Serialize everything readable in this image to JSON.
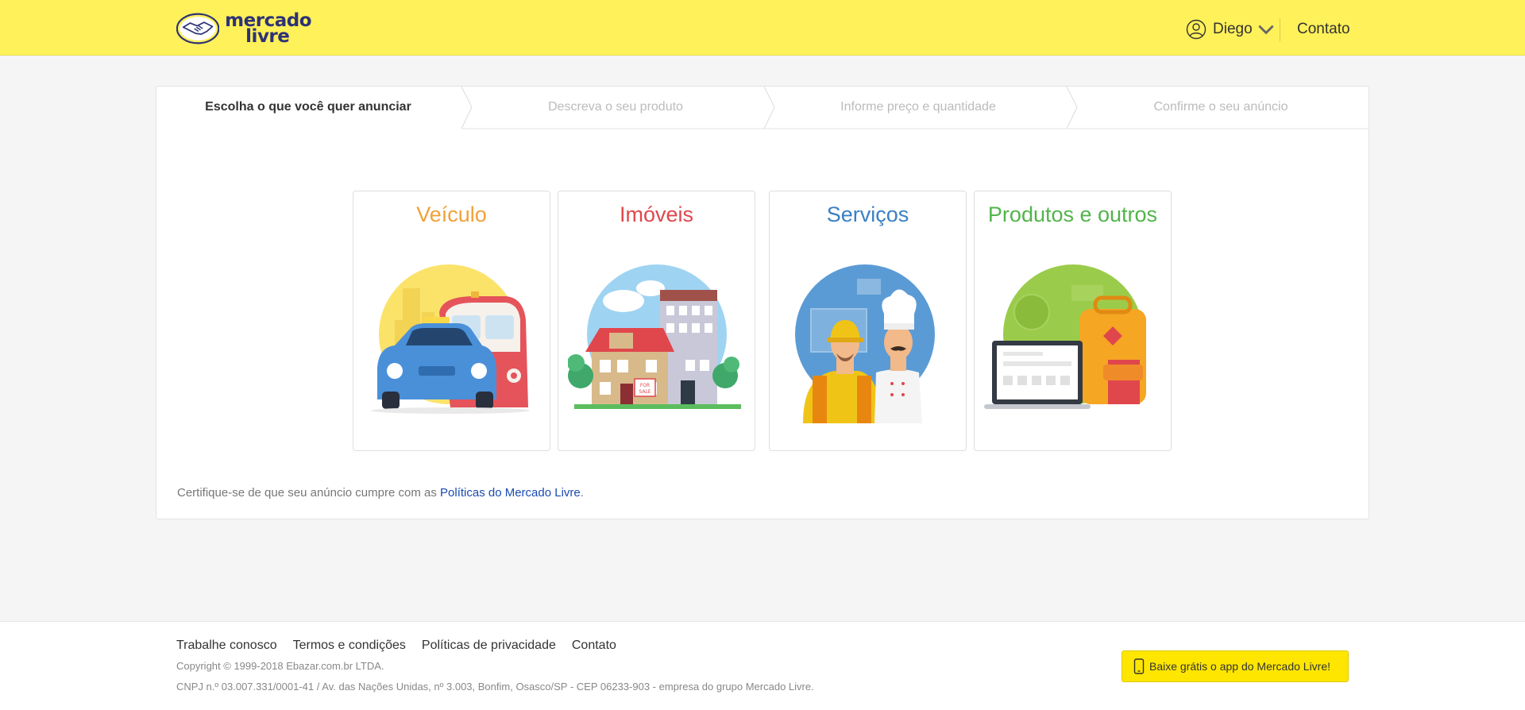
{
  "header": {
    "logo_line1": "mercado",
    "logo_line2": "livre",
    "user_name": "Diego",
    "contact": "Contato"
  },
  "steps": [
    {
      "label": "Escolha o que você quer anunciar",
      "active": true
    },
    {
      "label": "Descreva o seu produto",
      "active": false
    },
    {
      "label": "Informe preço e quantidade",
      "active": false
    },
    {
      "label": "Confirme o seu anúncio",
      "active": false
    }
  ],
  "categories": [
    {
      "title": "Veículo",
      "color": "#f0a13a"
    },
    {
      "title": "Imóveis",
      "color": "#e0474c"
    },
    {
      "title": "Serviços",
      "color": "#3a7fc4"
    },
    {
      "title": "Produtos e outros",
      "color": "#51b54a"
    }
  ],
  "policy": {
    "text": "Certifique-se de que seu anúncio cumpre com as ",
    "link": "Políticas do Mercado Livre",
    "end": "."
  },
  "footer": {
    "links": [
      "Trabalhe conosco",
      "Termos e condições",
      "Políticas de privacidade",
      "Contato"
    ],
    "copyright": "Copyright © 1999-2018 Ebazar.com.br LTDA.",
    "cnpj": "CNPJ n.º 03.007.331/0001-41 / Av. das Nações Unidas, nº 3.003, Bonfim, Osasco/SP - CEP 06233-903 - empresa do grupo Mercado Livre.",
    "app_button": "Baixe grátis o app do Mercado Livre!"
  },
  "colors": {
    "header_bg": "#fff159",
    "brand_navy": "#2d3277",
    "link": "#1b4bb0",
    "app_button_bg": "#ffe600"
  }
}
